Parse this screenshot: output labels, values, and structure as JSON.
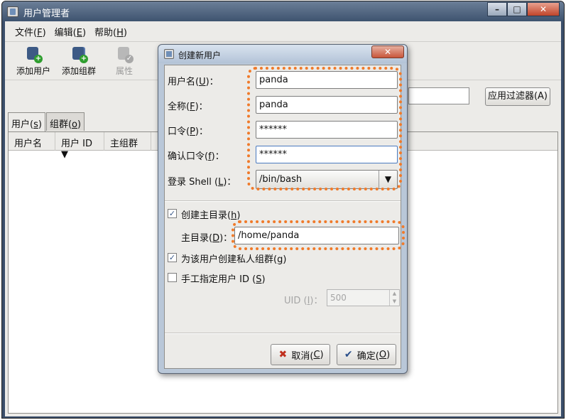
{
  "window": {
    "title": "用户管理者",
    "controls": [
      "–",
      "□",
      "✕"
    ]
  },
  "menu": [
    {
      "label": "文件(",
      "key": "F",
      "tail": ")"
    },
    {
      "label": "编辑(",
      "key": "E",
      "tail": ")"
    },
    {
      "label": "帮助(",
      "key": "H",
      "tail": ")"
    }
  ],
  "toolbar": {
    "add_user": "添加用户",
    "add_group": "添加组群",
    "properties": "属性"
  },
  "search": {
    "filter_button": "应用过滤器(A)"
  },
  "tabs": [
    {
      "label": "用户(",
      "key": "s",
      "tail": ")"
    },
    {
      "label": "组群(",
      "key": "o",
      "tail": ")"
    }
  ],
  "table": {
    "columns": [
      "用户名",
      "用户 ID ▼",
      "主组群"
    ]
  },
  "dialog": {
    "title": "创建新用户",
    "close": "✕",
    "username_label": {
      "pre": "用户名(",
      "key": "U",
      "post": ")："
    },
    "username_value": "panda",
    "fullname_label": {
      "pre": "全称(",
      "key": "F",
      "post": ")："
    },
    "fullname_value": "panda",
    "password_label": {
      "pre": "口令(",
      "key": "P",
      "post": ")："
    },
    "password_value": "******",
    "confirm_label": {
      "pre": "确认口令(",
      "key": "f",
      "post": ")："
    },
    "confirm_value": "******",
    "shell_label": {
      "pre": "登录 Shell (",
      "key": "L",
      "post": ")："
    },
    "shell_value": "/bin/bash",
    "create_home_label": {
      "pre": "创建主目录(",
      "key": "h",
      "post": ")"
    },
    "create_home_checked": "✓",
    "home_dir_label": {
      "pre": "主目录(",
      "key": "D",
      "post": ")："
    },
    "home_dir_value": "/home/panda",
    "private_group_label": {
      "pre": "为该用户创建私人组群(",
      "key": "g",
      "post": ")"
    },
    "private_group_checked": "✓",
    "manual_uid_label": {
      "pre": "手工指定用户 ID (",
      "key": "S",
      "post": ")"
    },
    "uid_label": {
      "pre": "UID (",
      "key": "I",
      "post": ")："
    },
    "uid_value": "500",
    "cancel_button": {
      "pre": "取消(",
      "key": "C",
      "post": ")"
    },
    "ok_button": {
      "pre": "确定(",
      "key": "O",
      "post": ")"
    }
  },
  "colors": {
    "highlight": "#f07a2a",
    "titlebar": "#3e536f"
  }
}
